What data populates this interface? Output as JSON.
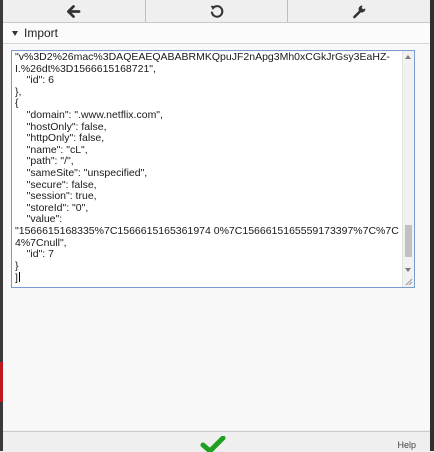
{
  "toolbar": {
    "buttons": [
      {
        "icon": "arrow-left-icon"
      },
      {
        "icon": "refresh-icon"
      },
      {
        "icon": "wrench-icon"
      }
    ]
  },
  "section": {
    "title": "Import",
    "icon": "caret-down-icon"
  },
  "editor": {
    "lines": [
      "\"v%3D2%26mac%3DAQEAEQABABRMKQpuJF2nApg3Mh0xCGkJrGsy3EaHZ-",
      "I.%26dt%3D1566615168721\",",
      "    \"id\": 6",
      "},",
      "{",
      "    \"domain\": \".www.netflix.com\",",
      "    \"hostOnly\": false,",
      "    \"httpOnly\": false,",
      "    \"name\": \"cL\",",
      "    \"path\": \"/\",",
      "    \"sameSite\": \"unspecified\",",
      "    \"secure\": false,",
      "    \"session\": true,",
      "    \"storeId\": \"0\",",
      "    \"value\":",
      "\"1566615168335%7C1566615165361974 0%7C1566615165559173397%7C%7C",
      "4%7Cnull\",",
      "    \"id\": 7",
      "}",
      "]"
    ]
  },
  "footer": {
    "confirm_icon": "checkmark-icon",
    "help_label": "Help"
  },
  "colors": {
    "confirm": "#20a020",
    "editor_border": "#7a9bcf",
    "side_accent": "#c0181e"
  }
}
